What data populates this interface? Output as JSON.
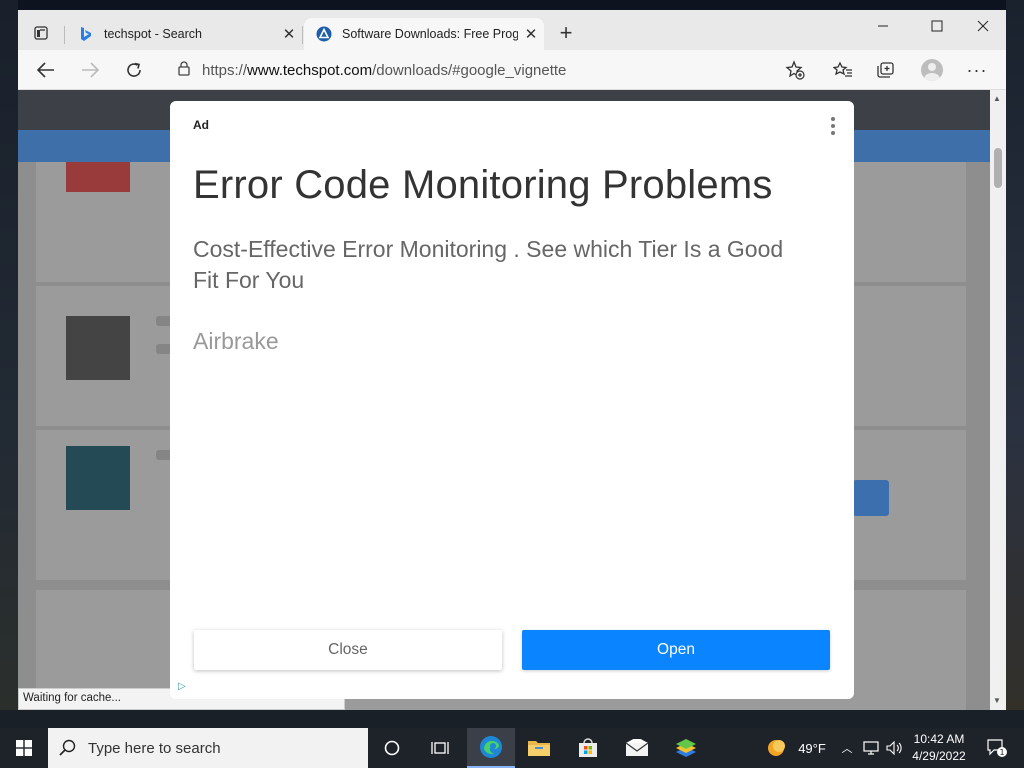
{
  "browser": {
    "tabs": [
      {
        "title": "techspot - Search",
        "favicon": "bing-icon",
        "active": false
      },
      {
        "title": "Software Downloads: Free Progra",
        "favicon": "techspot-icon",
        "active": true
      }
    ],
    "address": {
      "prefix": "https://",
      "host": "www.techspot.com",
      "path": "/downloads/#google_vignette"
    },
    "status_text": "Waiting for cache..."
  },
  "ad": {
    "label": "Ad",
    "headline": "Error Code Monitoring Problems",
    "description": "Cost-Effective Error Monitoring . See which Tier Is a Good Fit For You",
    "advertiser": "Airbrake",
    "close_label": "Close",
    "open_label": "Open",
    "open_color": "#0a84ff"
  },
  "taskbar": {
    "search_placeholder": "Type here to search",
    "weather": "49°F",
    "time": "10:42 AM",
    "date": "4/29/2022",
    "notification_count": "1"
  }
}
